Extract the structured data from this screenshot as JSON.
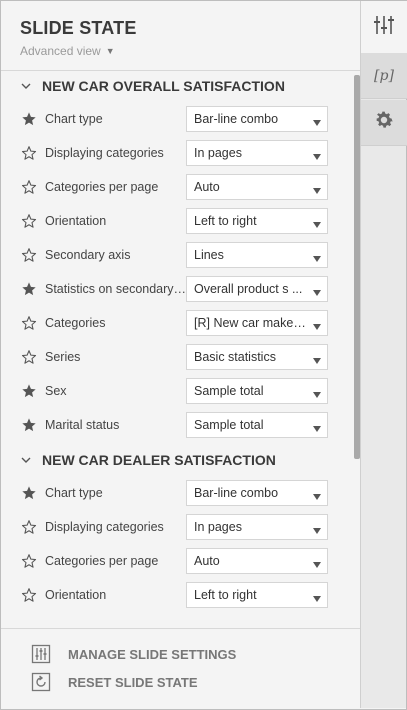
{
  "header": {
    "title": "SLIDE STATE",
    "view_label": "Advanced view"
  },
  "sections": [
    {
      "title": "NEW CAR OVERALL SATISFACTION",
      "rows": [
        {
          "label": "Chart type",
          "value": "Bar-line combo",
          "starred": true
        },
        {
          "label": "Displaying categories",
          "value": "In pages",
          "starred": false
        },
        {
          "label": "Categories per page",
          "value": "Auto",
          "starred": false
        },
        {
          "label": "Orientation",
          "value": "Left to right",
          "starred": false
        },
        {
          "label": "Secondary axis",
          "value": "Lines",
          "starred": false
        },
        {
          "label": "Statistics on secondary ...",
          "value": "Overall product s ...",
          "starred": true
        },
        {
          "label": "Categories",
          "value": "[R] New car make ...",
          "starred": false
        },
        {
          "label": "Series",
          "value": "Basic statistics",
          "starred": false
        },
        {
          "label": "Sex",
          "value": "Sample total",
          "starred": true
        },
        {
          "label": "Marital status",
          "value": "Sample total",
          "starred": true
        }
      ]
    },
    {
      "title": "NEW CAR DEALER SATISFACTION",
      "rows": [
        {
          "label": "Chart type",
          "value": "Bar-line combo",
          "starred": true
        },
        {
          "label": "Displaying categories",
          "value": "In pages",
          "starred": false
        },
        {
          "label": "Categories per page",
          "value": "Auto",
          "starred": false
        },
        {
          "label": "Orientation",
          "value": "Left to right",
          "starred": false
        }
      ]
    }
  ],
  "footer": {
    "manage_label": "MANAGE SLIDE SETTINGS",
    "reset_label": "RESET SLIDE STATE"
  },
  "sidebar": {
    "param_label": "[p]"
  },
  "colors": {
    "star_filled": "#555555",
    "star_outline": "#555555",
    "panel_bg": "#f4f4f4",
    "sidebar_bg": "#e9e9e9"
  }
}
